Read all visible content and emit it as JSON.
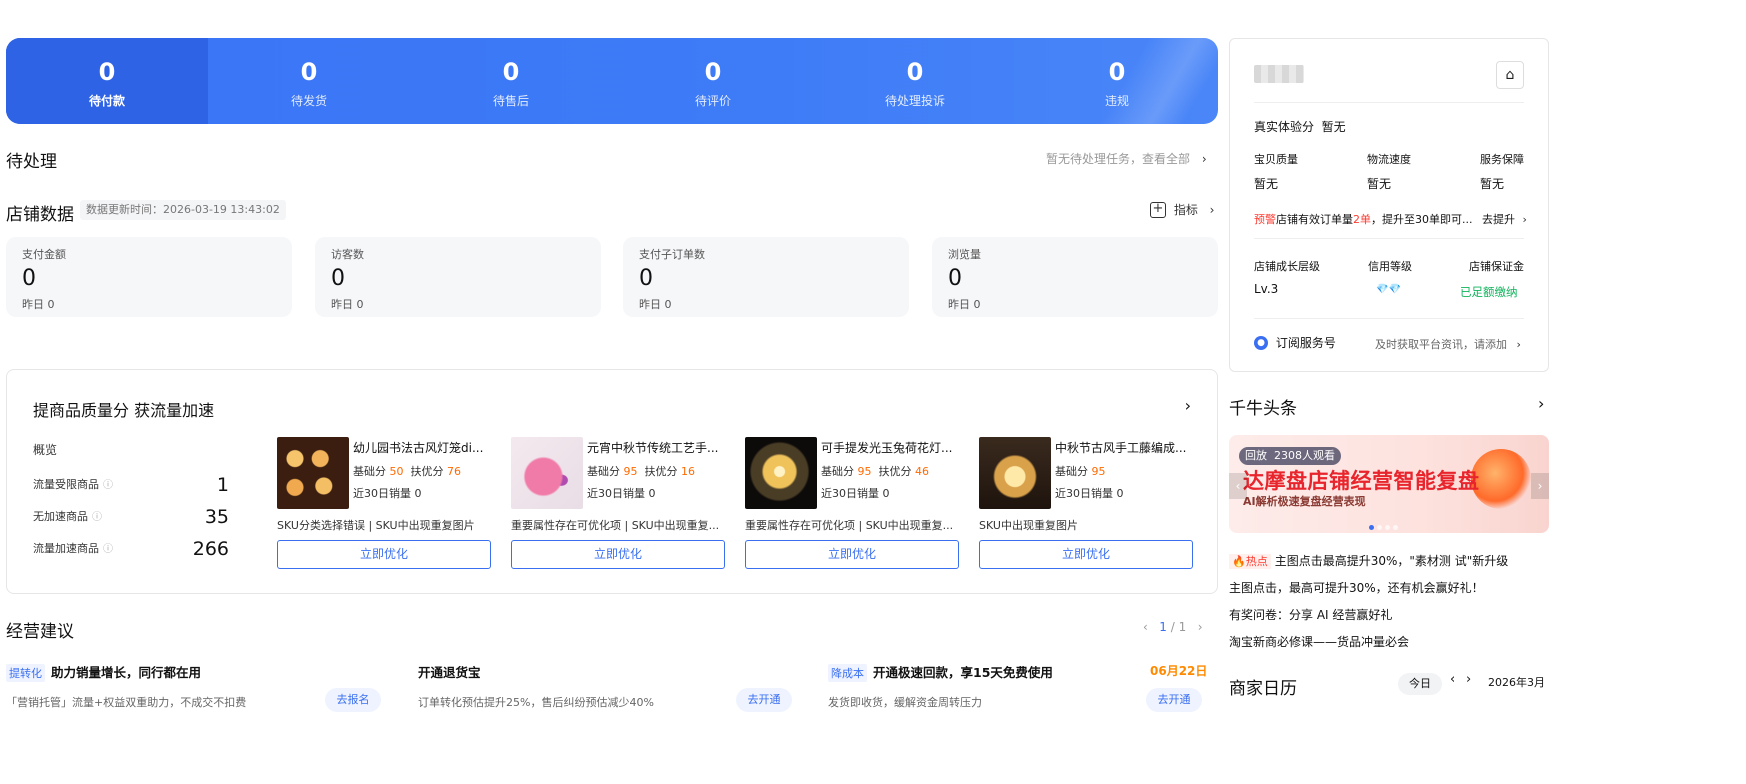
{
  "banner": {
    "items": [
      {
        "value": "0",
        "label": "待付款"
      },
      {
        "value": "0",
        "label": "待发货"
      },
      {
        "value": "0",
        "label": "待售后"
      },
      {
        "value": "0",
        "label": "待评价"
      },
      {
        "value": "0",
        "label": "待处理投诉"
      },
      {
        "value": "0",
        "label": "违规"
      }
    ]
  },
  "pending": {
    "title": "待处理",
    "link": "暂无待处理任务，查看全部"
  },
  "shop_data": {
    "title": "店铺数据",
    "updated": "数据更新时间：2026-03-19 13:43:02",
    "metrics_link": "指标",
    "metrics": [
      {
        "label": "支付金额",
        "value": "0",
        "yesterday": "昨日 0"
      },
      {
        "label": "访客数",
        "value": "0",
        "yesterday": "昨日 0"
      },
      {
        "label": "支付子订单数",
        "value": "0",
        "yesterday": "昨日 0"
      },
      {
        "label": "浏览量",
        "value": "0",
        "yesterday": "昨日 0"
      }
    ]
  },
  "quality": {
    "title": "提商品质量分 获流量加速",
    "overview_label": "概览",
    "overview": [
      {
        "label": "流量受限商品",
        "value": "1"
      },
      {
        "label": "无加速商品",
        "value": "35"
      },
      {
        "label": "流量加速商品",
        "value": "266"
      }
    ],
    "products": [
      {
        "name": "幼儿园书法古风灯笼di...",
        "base_label": "基础分",
        "base": "50",
        "sup_label": "扶优分",
        "sup": "76",
        "sales": "近30日销量 0",
        "tip": "SKU分类选择错误 | SKU中出现重复图片",
        "button": "立即优化"
      },
      {
        "name": "元宵中秋节传统工艺手...",
        "base_label": "基础分",
        "base": "95",
        "sup_label": "扶优分",
        "sup": "16",
        "sales": "近30日销量 0",
        "tip": "重要属性存在可优化项 | SKU中出现重复...",
        "button": "立即优化"
      },
      {
        "name": "可手提发光玉兔荷花灯...",
        "base_label": "基础分",
        "base": "95",
        "sup_label": "扶优分",
        "sup": "46",
        "sales": "近30日销量 0",
        "tip": "重要属性存在可优化项 | SKU中出现重复...",
        "button": "立即优化"
      },
      {
        "name": "中秋节古风手工藤编成...",
        "base_label": "基础分",
        "base": "95",
        "sup_label": "",
        "sup": "",
        "sales": "近30日销量 0",
        "tip": "SKU中出现重复图片",
        "button": "立即优化"
      }
    ]
  },
  "advice": {
    "title": "经营建议",
    "page_current": "1",
    "page_total": "/ 1",
    "items": [
      {
        "tag": "提转化",
        "title": "助力销量增长，同行都在用",
        "desc": "「营销托管」流量+权益双重助力，不成交不扣费",
        "button": "去报名"
      },
      {
        "tag": "",
        "title": "开通退货宝",
        "desc": "订单转化预估提升25%，售后纠纷预估减少40%",
        "button": "去开通"
      },
      {
        "tag": "降成本",
        "title": "开通极速回款，享15天免费使用",
        "desc": "发货即收货，缓解资金周转压力",
        "button": "去开通",
        "date": "06月22日"
      }
    ]
  },
  "profile": {
    "experience_label": "真实体验分",
    "experience_value": "暂无",
    "dims": [
      {
        "label": "宝贝质量",
        "value": "暂无"
      },
      {
        "label": "物流速度",
        "value": "暂无"
      },
      {
        "label": "服务保障",
        "value": "暂无"
      }
    ],
    "warning_tag": "预警",
    "warning_text_1": "店铺有效订单量",
    "warning_count": "2单",
    "warning_text_2": "，提升至30单即可...",
    "warning_action": "去提升",
    "levels": [
      {
        "label": "店铺成长层级",
        "value": "Lv.3"
      },
      {
        "label": "信用等级",
        "value": "💎💎"
      },
      {
        "label": "店铺保证金",
        "value": "已足额缴纳"
      }
    ],
    "subscribe_label": "订阅服务号",
    "subscribe_hint": "及时获取平台资讯，请添加"
  },
  "headlines": {
    "title": "千牛头条",
    "promo": {
      "live_tag": "回放",
      "viewers": "2308人观看",
      "headline": "达摩盘店铺经营智能复盘",
      "subline": "AI解析极速复盘经营表现"
    },
    "news": [
      {
        "hot": "热点",
        "text": "主图点击最高提升30%，\"素材测 试\"新升级"
      },
      {
        "hot": "",
        "text": "主图点击，最高可提升30%，还有机会赢好礼！"
      },
      {
        "hot": "",
        "text": "有奖问卷：分享 AI 经营赢好礼"
      },
      {
        "hot": "",
        "text": "淘宝新商必修课——货品冲量必会"
      }
    ]
  },
  "calendar": {
    "title": "商家日历",
    "today": "今日",
    "month": "2026年3月"
  },
  "colors": {
    "accent": "#3a6ff2",
    "banner": "#3d7bf7",
    "warning": "#ff3b30",
    "score_orange": "#ff6a00",
    "success": "#11b35c"
  }
}
